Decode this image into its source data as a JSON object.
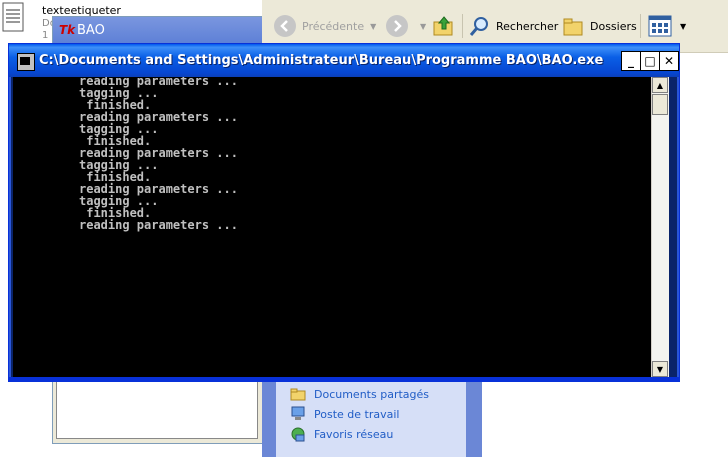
{
  "background_file": {
    "name": "texteetiqueter",
    "meta_line1": "Do",
    "meta_line2": "1"
  },
  "tk_window": {
    "icon_glyph": "Tk",
    "title": "BAO"
  },
  "explorer": {
    "toolbar": {
      "back_label": "Précédente",
      "search_label": "Rechercher",
      "folders_label": "Dossiers"
    },
    "task_links": [
      {
        "label": "Documents partagés",
        "icon": "folder-icon"
      },
      {
        "label": "Poste de travail",
        "icon": "computer-icon"
      },
      {
        "label": "Favoris réseau",
        "icon": "network-icon"
      }
    ]
  },
  "console": {
    "title": "C:\\Documents and Settings\\Administrateur\\Bureau\\Programme BAO\\BAO.exe",
    "minimize_glyph": "_",
    "maximize_glyph": "□",
    "close_glyph": "✕",
    "lines": [
      "reading parameters ...",
      "tagging ...",
      " finished.",
      "reading parameters ...",
      "tagging ...",
      " finished.",
      "reading parameters ...",
      "tagging ...",
      " finished.",
      "reading parameters ...",
      "tagging ...",
      " finished.",
      "reading parameters ..."
    ]
  },
  "colors": {
    "title_bar_blue": "#0a5fe6",
    "console_bg": "#000000",
    "console_text": "#c0c0c0",
    "task_pane_blue": "#6b87d6"
  }
}
